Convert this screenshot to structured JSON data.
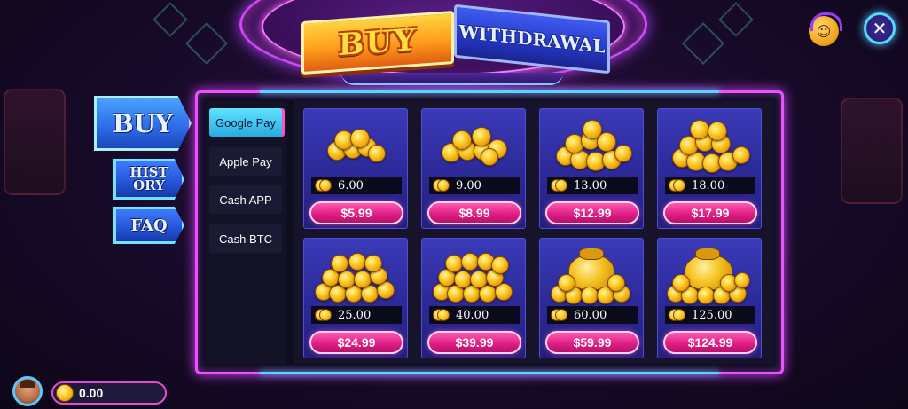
{
  "header": {
    "tabs": [
      {
        "label": "BUY",
        "active": true
      },
      {
        "label": "WITHDRAWAL",
        "active": false
      }
    ]
  },
  "top_right": {
    "support_icon": "headset-smiley-icon",
    "close_icon": "close-icon",
    "close_glyph": "✕"
  },
  "sidebar": {
    "items": [
      {
        "label": "BUY",
        "active": true
      },
      {
        "label": "HIST\nORY",
        "active": false
      },
      {
        "label": "FAQ",
        "active": false
      }
    ]
  },
  "payment_methods": [
    {
      "label": "Google Pay",
      "active": true
    },
    {
      "label": "Apple Pay",
      "active": false
    },
    {
      "label": "Cash APP",
      "active": false
    },
    {
      "label": "Cash BTC",
      "active": false
    }
  ],
  "packages": [
    {
      "amount": "6.00",
      "price": "$5.99",
      "icon": "small-coin-pile-icon"
    },
    {
      "amount": "9.00",
      "price": "$8.99",
      "icon": "small-coin-pile-icon"
    },
    {
      "amount": "13.00",
      "price": "$12.99",
      "icon": "coin-pile-icon"
    },
    {
      "amount": "18.00",
      "price": "$17.99",
      "icon": "coin-pile-icon"
    },
    {
      "amount": "25.00",
      "price": "$24.99",
      "icon": "coin-stack-icon"
    },
    {
      "amount": "40.00",
      "price": "$39.99",
      "icon": "coin-stack-icon"
    },
    {
      "amount": "60.00",
      "price": "$59.99",
      "icon": "coin-bag-icon"
    },
    {
      "amount": "125.00",
      "price": "$124.99",
      "icon": "coin-bag-icon"
    }
  ],
  "wallet": {
    "balance": "0.00"
  },
  "colors": {
    "accent_pink": "#e01f86",
    "accent_cyan": "#56d6ff",
    "frame_magenta": "#e754ff",
    "gold": "#ffcf2d"
  }
}
